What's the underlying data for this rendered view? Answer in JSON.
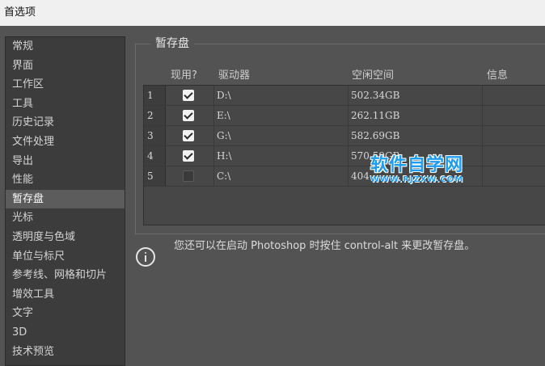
{
  "window": {
    "title": "首选项"
  },
  "sidebar": {
    "items": [
      {
        "label": "常规"
      },
      {
        "label": "界面"
      },
      {
        "label": "工作区"
      },
      {
        "label": "工具"
      },
      {
        "label": "历史记录"
      },
      {
        "label": "文件处理"
      },
      {
        "label": "导出"
      },
      {
        "label": "性能"
      },
      {
        "label": "暂存盘"
      },
      {
        "label": "光标"
      },
      {
        "label": "透明度与色域"
      },
      {
        "label": "单位与标尺"
      },
      {
        "label": "参考线、网格和切片"
      },
      {
        "label": "增效工具"
      },
      {
        "label": "文字"
      },
      {
        "label": "3D"
      },
      {
        "label": "技术预览"
      }
    ],
    "selected": "暂存盘"
  },
  "scratch": {
    "group_title": "暂存盘",
    "headers": {
      "active": "现用?",
      "drive": "驱动器",
      "free": "空闲空间",
      "info": "信息"
    },
    "rows": [
      {
        "num": "1",
        "checked": true,
        "drive": "D:\\",
        "free": "502.34GB"
      },
      {
        "num": "2",
        "checked": true,
        "drive": "E:\\",
        "free": "262.11GB"
      },
      {
        "num": "3",
        "checked": true,
        "drive": "G:\\",
        "free": "582.69GB"
      },
      {
        "num": "4",
        "checked": true,
        "drive": "H:\\",
        "free": "570.59GB"
      },
      {
        "num": "5",
        "checked": false,
        "drive": "C:\\",
        "free": "404"
      }
    ]
  },
  "info": {
    "text": "您还可以在启动 Photoshop 时按住 control-alt 来更改暂存盘。"
  },
  "watermark": {
    "line1": "软件自学网",
    "line2": "WWW.RJZXW.COM",
    "color": "#1e9cf0"
  },
  "icons": {
    "info": "info-circle-icon",
    "check": "checkmark-icon"
  }
}
